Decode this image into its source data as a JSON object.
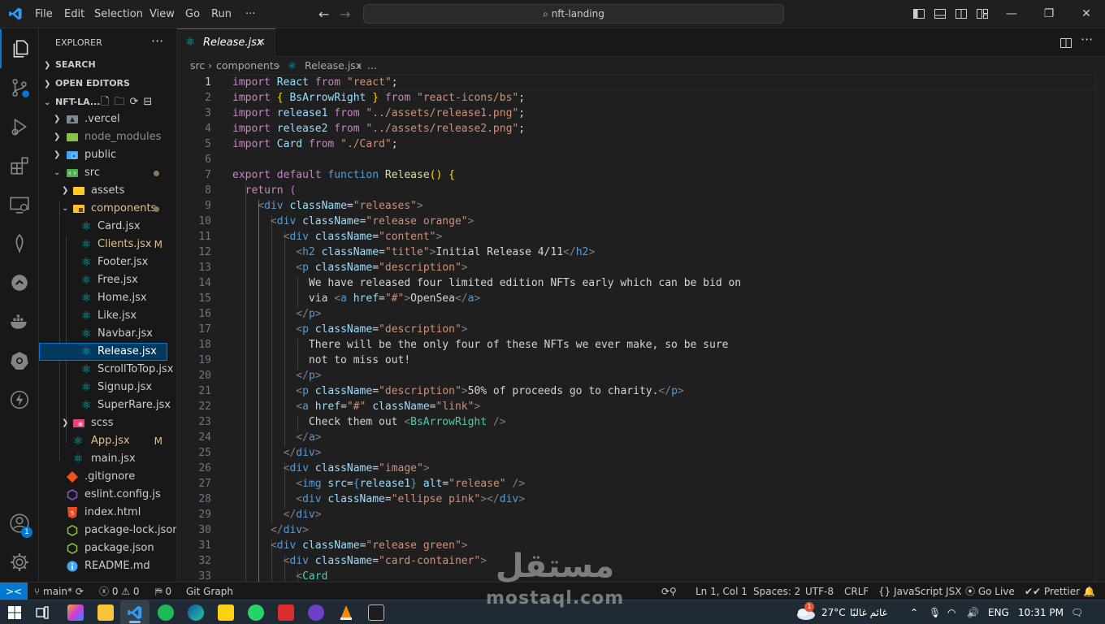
{
  "titlebar": {
    "menus": [
      "File",
      "Edit",
      "Selection",
      "View",
      "Go",
      "Run",
      "···"
    ],
    "command_center": "nft-landing",
    "controls": [
      "—",
      "❐",
      "✕"
    ]
  },
  "activity": {
    "accounts_badge": "1"
  },
  "sidebar": {
    "header": "EXPLORER",
    "more": "···",
    "sections": {
      "search": "SEARCH",
      "open_editors": "OPEN EDITORS",
      "folder": "NFT-LA..."
    },
    "tree": [
      {
        "name": ".vercel",
        "status": ""
      },
      {
        "name": "node_modules",
        "status": ""
      },
      {
        "name": "public",
        "status": ""
      },
      {
        "name": "src",
        "status": ""
      },
      {
        "name": "assets",
        "status": ""
      },
      {
        "name": "components",
        "status": ""
      },
      {
        "name": "Card.jsx",
        "status": ""
      },
      {
        "name": "Clients.jsx",
        "status": "M"
      },
      {
        "name": "Footer.jsx",
        "status": ""
      },
      {
        "name": "Free.jsx",
        "status": ""
      },
      {
        "name": "Home.jsx",
        "status": ""
      },
      {
        "name": "Like.jsx",
        "status": ""
      },
      {
        "name": "Navbar.jsx",
        "status": ""
      },
      {
        "name": "Release.jsx",
        "status": ""
      },
      {
        "name": "ScrollToTop.jsx",
        "status": ""
      },
      {
        "name": "Signup.jsx",
        "status": ""
      },
      {
        "name": "SuperRare.jsx",
        "status": ""
      },
      {
        "name": "scss",
        "status": ""
      },
      {
        "name": "App.jsx",
        "status": "M"
      },
      {
        "name": "main.jsx",
        "status": ""
      },
      {
        "name": ".gitignore",
        "status": ""
      },
      {
        "name": "eslint.config.js",
        "status": ""
      },
      {
        "name": "index.html",
        "status": ""
      },
      {
        "name": "package-lock.json",
        "status": ""
      },
      {
        "name": "package.json",
        "status": ""
      },
      {
        "name": "README.md",
        "status": ""
      }
    ]
  },
  "editor": {
    "tab": {
      "label": "Release.jsx",
      "close": "✕"
    },
    "breadcrumb": [
      "src",
      "components",
      "Release.jsx",
      "..."
    ],
    "line_numbers": [
      "1",
      "2",
      "3",
      "4",
      "5",
      "6",
      "7",
      "8",
      "9",
      "10",
      "11",
      "12",
      "13",
      "14",
      "15",
      "16",
      "17",
      "18",
      "19",
      "20",
      "21",
      "22",
      "23",
      "24",
      "25",
      "26",
      "27",
      "28",
      "29",
      "30",
      "31",
      "32",
      "33"
    ],
    "code": {
      "l1_react": "React",
      "l1_src": "\"react\"",
      "l2_named": "BsArrowRight",
      "l2_src": "\"react-icons/bs\"",
      "l3_name": "release1",
      "l3_src": "\"../assets/release1.png\"",
      "l4_name": "release2",
      "l4_src": "\"../assets/release2.png\"",
      "l5_name": "Card",
      "l5_src": "\"./Card\"",
      "l7_fn": "Release",
      "cls_releases": "\"releases\"",
      "cls_release_orange": "\"release orange\"",
      "cls_content": "\"content\"",
      "cls_title": "\"title\"",
      "h2_text": "Initial Release 4/11",
      "cls_description": "\"description\"",
      "p1_line1": "We have released four limited edition NFTs early which can be bid on",
      "p1_via": "via ",
      "href_hash": "\"#\"",
      "a_text": "OpenSea",
      "p2_line1": "There will be the only four of these NFTs we ever make, so be sure",
      "p2_line2": "not to miss out!",
      "p3_text": "50% of proceeds go to charity.",
      "cls_link": "\"link\"",
      "check_text": "Check them out ",
      "cls_image": "\"image\"",
      "img_src": "release1",
      "alt_val": "\"release\"",
      "cls_ellipse_pink": "\"ellipse pink\"",
      "cls_release_green": "\"release green\"",
      "cls_card_container": "\"card-container\""
    }
  },
  "statusbar": {
    "remote": "><",
    "branch": "main*",
    "errors": "0",
    "warnings": "0",
    "ports": "0",
    "git_graph": "Git Graph",
    "position": "Ln 1, Col 1",
    "spaces": "Spaces: 2",
    "encoding": "UTF-8",
    "eol": "CRLF",
    "language": "JavaScript JSX",
    "golive": "Go Live",
    "prettier": "Prettier"
  },
  "taskbar": {
    "weather_badge": "1",
    "temperature": "27°C",
    "weather_text": "غائم غالبًا",
    "lang": "ENG",
    "time": "10:31 PM"
  },
  "watermark": {
    "arabic": "مستقل",
    "latin": "mostaql.com"
  },
  "colors": {
    "accent": "#0078d4",
    "keyword": "#c586c0",
    "string": "#ce9178",
    "variable": "#9cdcfe",
    "tag": "#569cd6",
    "component": "#4ec9b0",
    "function": "#dcdcaa"
  }
}
